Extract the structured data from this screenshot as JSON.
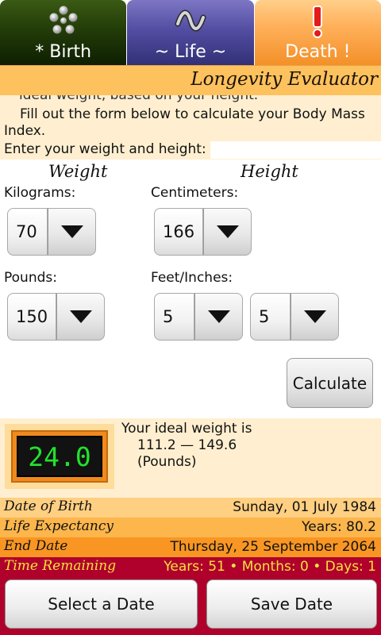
{
  "tabs": [
    {
      "label": "* Birth",
      "icon": "dots-flower-icon"
    },
    {
      "label": "~ Life ~",
      "icon": "wave-icon"
    },
    {
      "label": "Death !",
      "icon": "exclamation-icon"
    }
  ],
  "header": {
    "title": "Longevity Evaluator"
  },
  "description": {
    "cut_line": "ideal weight, based on your height.",
    "paragraph": "Fill out the form below to calculate your Body Mass Index.",
    "prompt": "Enter your weight and height:"
  },
  "form": {
    "weight_heading": "Weight",
    "height_heading": "Height",
    "kilograms_label": "Kilograms:",
    "kilograms_value": "70",
    "centimeters_label": "Centimeters:",
    "centimeters_value": "166",
    "pounds_label": "Pounds:",
    "pounds_value": "150",
    "feet_inches_label": "Feet/Inches:",
    "feet_value": "5",
    "inches_value": "5",
    "calculate_label": "Calculate"
  },
  "result": {
    "bmi": "24.0",
    "ideal_intro": "Your ideal weight is",
    "ideal_range": "111.2 — 149.6",
    "ideal_unit": "(Pounds)"
  },
  "info": {
    "dob_label": "Date of Birth",
    "dob_value": "Sunday, 01 July 1984",
    "life_label": "Life Expectancy",
    "life_value": "Years: 80.2",
    "end_label": "End Date",
    "end_value": "Thursday, 25 September 2064",
    "remaining_label": "Time Remaining",
    "remaining_value": "Years: 51 • Months: 0 • Days: 1"
  },
  "buttons": {
    "select_date": "Select a Date",
    "save_date": "Save Date"
  },
  "colors": {
    "birth_tab": "#233c08",
    "life_tab": "#534ea3",
    "death_tab": "#ffb05a",
    "title_bar": "#fdc15e",
    "panel": "#ffefd0",
    "lcd_text": "#21e22c",
    "remaining_bar": "#b0002c",
    "remaining_text": "#f5e23c"
  }
}
